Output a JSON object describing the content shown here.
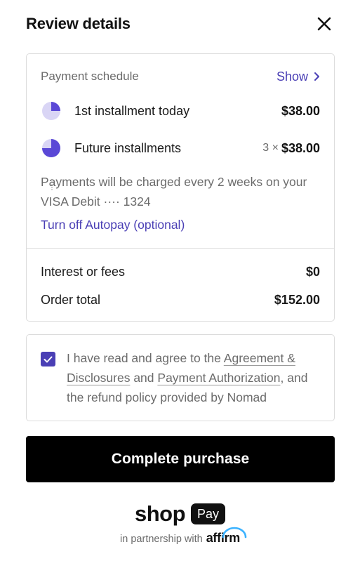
{
  "header": {
    "title": "Review details",
    "close_icon": "close-icon"
  },
  "schedule": {
    "label": "Payment schedule",
    "show_label": "Show",
    "installments": [
      {
        "label": "1st installment today",
        "multiplier": "",
        "amount": "$38.00",
        "icon": "pie-quarter-icon"
      },
      {
        "label": "Future installments",
        "multiplier": "3 ×",
        "amount": "$38.00",
        "icon": "pie-three-quarter-icon"
      }
    ],
    "note": "Payments will be charged every 2 weeks on your VISA Debit ···· 1324",
    "autopay_link": "Turn off Autopay (optional)"
  },
  "summary": {
    "rows": [
      {
        "label": "Interest or fees",
        "value": "$0"
      },
      {
        "label": "Order total",
        "value": "$152.00"
      }
    ]
  },
  "agreement": {
    "checked": true,
    "text_1": "I have read and agree to the ",
    "link_1": "Agreement & Disclosures",
    "text_2": " and ",
    "link_2": "Payment Authorization",
    "text_3": ", and the refund policy provided by Nomad"
  },
  "cta": {
    "label": "Complete purchase"
  },
  "footer": {
    "brand_word": "shop",
    "brand_badge": "Pay",
    "partner_text": "in partnership with",
    "partner_brand": "affirm"
  },
  "colors": {
    "accent": "#4a3fb5",
    "pie_light": "#d9d5f5",
    "text_muted": "#6b6b6b",
    "border": "#dcdcdc",
    "button_bg": "#000000",
    "affirm_arc": "#3bb2ff"
  }
}
